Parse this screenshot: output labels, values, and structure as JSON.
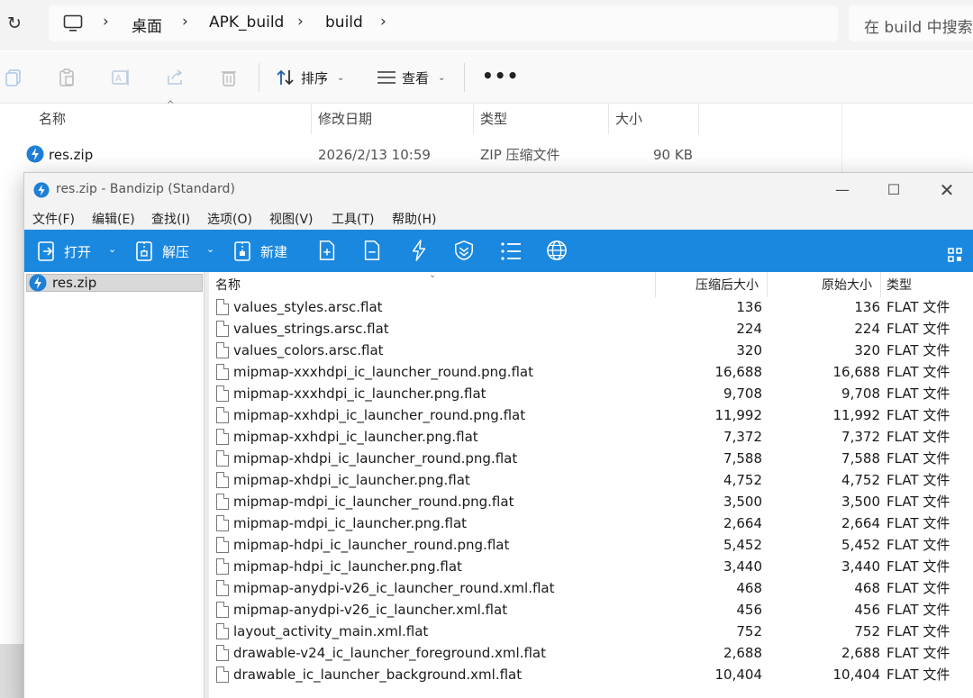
{
  "explorer": {
    "breadcrumb": [
      "桌面",
      "APK_build",
      "build"
    ],
    "search_placeholder": "在 build 中搜索",
    "toolbar": {
      "sort_label": "排序",
      "view_label": "查看",
      "more_label": "•••"
    },
    "columns": {
      "name": "名称",
      "modified": "修改日期",
      "type": "类型",
      "size": "大小"
    },
    "files": [
      {
        "name": "res.zip",
        "modified": "2026/2/13 10:59",
        "type": "ZIP 压缩文件",
        "size": "90 KB"
      }
    ]
  },
  "bandizip": {
    "title": "res.zip - Bandizip (Standard)",
    "menu": [
      "文件(F)",
      "编辑(E)",
      "查找(I)",
      "选项(O)",
      "视图(V)",
      "工具(T)",
      "帮助(H)"
    ],
    "toolbar": {
      "open_label": "打开",
      "extract_label": "解压",
      "new_label": "新建"
    },
    "tree": {
      "root_label": "res.zip"
    },
    "columns": {
      "name": "名称",
      "compressed": "压缩后大小",
      "original": "原始大小",
      "type": "类型"
    },
    "files": [
      {
        "name": "values_styles.arsc.flat",
        "compressed": "136",
        "original": "136",
        "type": "FLAT 文件"
      },
      {
        "name": "values_strings.arsc.flat",
        "compressed": "224",
        "original": "224",
        "type": "FLAT 文件"
      },
      {
        "name": "values_colors.arsc.flat",
        "compressed": "320",
        "original": "320",
        "type": "FLAT 文件"
      },
      {
        "name": "mipmap-xxxhdpi_ic_launcher_round.png.flat",
        "compressed": "16,688",
        "original": "16,688",
        "type": "FLAT 文件"
      },
      {
        "name": "mipmap-xxxhdpi_ic_launcher.png.flat",
        "compressed": "9,708",
        "original": "9,708",
        "type": "FLAT 文件"
      },
      {
        "name": "mipmap-xxhdpi_ic_launcher_round.png.flat",
        "compressed": "11,992",
        "original": "11,992",
        "type": "FLAT 文件"
      },
      {
        "name": "mipmap-xxhdpi_ic_launcher.png.flat",
        "compressed": "7,372",
        "original": "7,372",
        "type": "FLAT 文件"
      },
      {
        "name": "mipmap-xhdpi_ic_launcher_round.png.flat",
        "compressed": "7,588",
        "original": "7,588",
        "type": "FLAT 文件"
      },
      {
        "name": "mipmap-xhdpi_ic_launcher.png.flat",
        "compressed": "4,752",
        "original": "4,752",
        "type": "FLAT 文件"
      },
      {
        "name": "mipmap-mdpi_ic_launcher_round.png.flat",
        "compressed": "3,500",
        "original": "3,500",
        "type": "FLAT 文件"
      },
      {
        "name": "mipmap-mdpi_ic_launcher.png.flat",
        "compressed": "2,664",
        "original": "2,664",
        "type": "FLAT 文件"
      },
      {
        "name": "mipmap-hdpi_ic_launcher_round.png.flat",
        "compressed": "5,452",
        "original": "5,452",
        "type": "FLAT 文件"
      },
      {
        "name": "mipmap-hdpi_ic_launcher.png.flat",
        "compressed": "3,440",
        "original": "3,440",
        "type": "FLAT 文件"
      },
      {
        "name": "mipmap-anydpi-v26_ic_launcher_round.xml.flat",
        "compressed": "468",
        "original": "468",
        "type": "FLAT 文件"
      },
      {
        "name": "mipmap-anydpi-v26_ic_launcher.xml.flat",
        "compressed": "456",
        "original": "456",
        "type": "FLAT 文件"
      },
      {
        "name": "layout_activity_main.xml.flat",
        "compressed": "752",
        "original": "752",
        "type": "FLAT 文件"
      },
      {
        "name": "drawable-v24_ic_launcher_foreground.xml.flat",
        "compressed": "2,688",
        "original": "2,688",
        "type": "FLAT 文件"
      },
      {
        "name": "drawable_ic_launcher_background.xml.flat",
        "compressed": "10,404",
        "original": "10,404",
        "type": "FLAT 文件"
      }
    ]
  },
  "colors": {
    "toolbar_blue": "#1b88e0",
    "window_bg": "#f3f3f3"
  },
  "icons": [
    "refresh-icon",
    "computer-icon",
    "chevron-right-icon",
    "copy-icon",
    "paste-icon",
    "rename-icon",
    "share-icon",
    "delete-icon",
    "sort-icon",
    "view-icon",
    "bandizip-zip-icon",
    "open-icon",
    "extract-icon",
    "new-archive-icon",
    "add-file-icon",
    "remove-file-icon",
    "test-icon",
    "antivirus-icon",
    "list-icon",
    "web-icon",
    "layout-icon",
    "file-icon"
  ]
}
